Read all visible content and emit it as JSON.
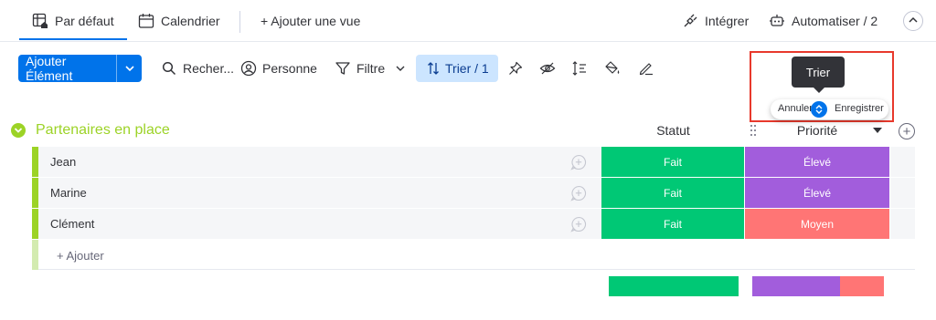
{
  "views": {
    "tabs": [
      {
        "label": "Par défaut",
        "icon": "table-home-icon"
      },
      {
        "label": "Calendrier",
        "icon": "calendar-icon"
      },
      {
        "label": "+ Ajouter une vue",
        "icon": ""
      }
    ],
    "integrate_label": "Intégrer",
    "automate_label": "Automatiser / 2"
  },
  "toolbar": {
    "add_item_label": "Ajouter Élément",
    "search_label": "Recher...",
    "person_label": "Personne",
    "filter_label": "Filtre",
    "sort_label": "Trier / 1"
  },
  "tooltip": {
    "text": "Trier",
    "cancel_label": "Annuler",
    "save_label": "Enregistrer"
  },
  "group": {
    "title": "Partenaires en place",
    "color": "#9cd326",
    "columns": {
      "status": "Statut",
      "priority": "Priorité"
    },
    "rows": [
      {
        "name": "Jean",
        "status": "Fait",
        "status_color": "#00c875",
        "priority": "Élevé",
        "priority_color": "#a25ddc"
      },
      {
        "name": "Marine",
        "status": "Fait",
        "status_color": "#00c875",
        "priority": "Élevé",
        "priority_color": "#a25ddc"
      },
      {
        "name": "Clément",
        "status": "Fait",
        "status_color": "#00c875",
        "priority": "Moyen",
        "priority_color": "#ff7575"
      }
    ],
    "add_label": "+ Ajouter",
    "summary": {
      "status": [
        {
          "color": "#00c875",
          "fraction": 1.0
        }
      ],
      "priority": [
        {
          "color": "#a25ddc",
          "fraction": 0.6667
        },
        {
          "color": "#ff7575",
          "fraction": 0.3333
        }
      ]
    }
  }
}
